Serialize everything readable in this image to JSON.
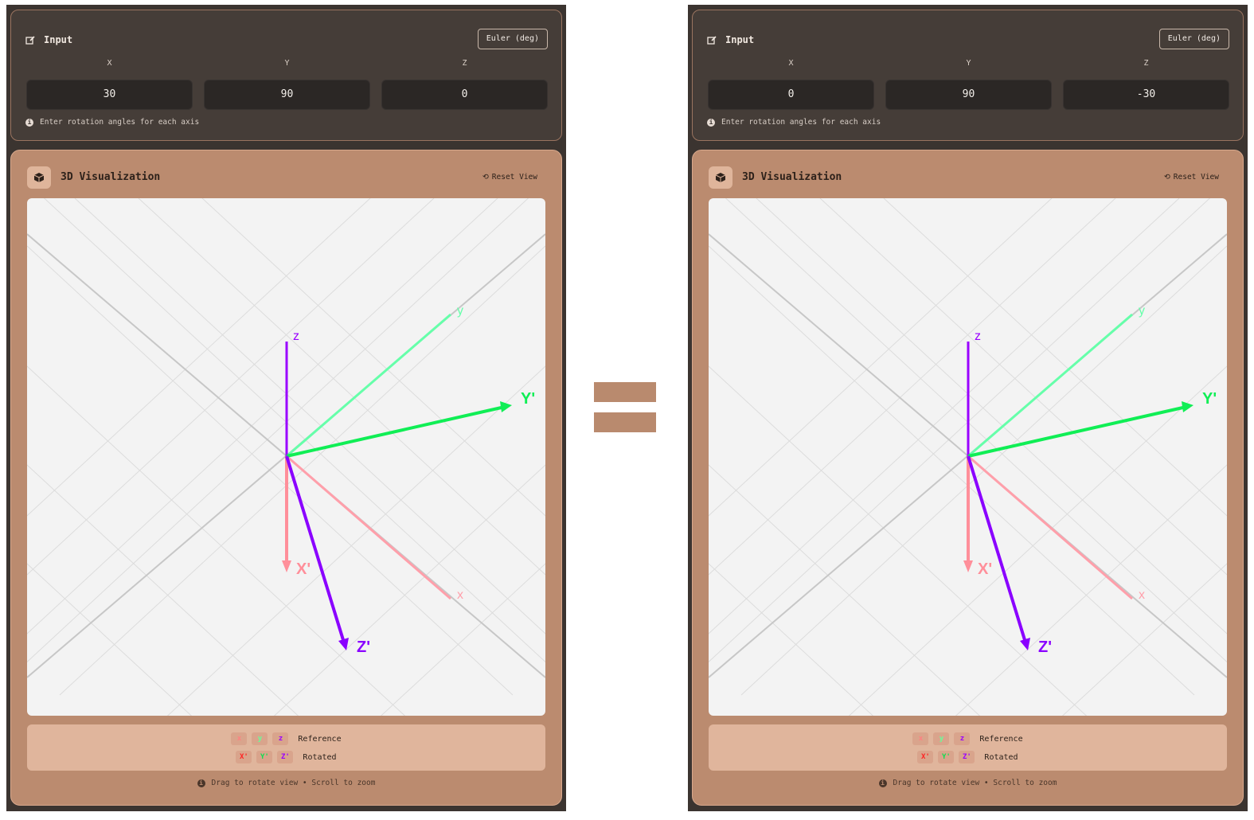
{
  "colors": {
    "panel_bg": "#3b3430",
    "viz_bg": "#bb8b6f",
    "ref_x": "#ff8f9a",
    "ref_y": "#66ffaa",
    "ref_z": "#9a00ff",
    "rot_x": "#ff8f9a",
    "rot_y": "#10ee55",
    "rot_z": "#8a00ff"
  },
  "panels": [
    {
      "input": {
        "title": "Input",
        "mode_button": "Euler (deg)",
        "axes": [
          {
            "label": "X",
            "value": "30"
          },
          {
            "label": "Y",
            "value": "90"
          },
          {
            "label": "Z",
            "value": "0"
          }
        ],
        "hint": "Enter rotation angles for each axis"
      },
      "viz": {
        "title": "3D Visualization",
        "reset_label": "Reset View",
        "axis_labels": {
          "x": "x",
          "y": "y",
          "z": "z",
          "xp": "X'",
          "yp": "Y'",
          "zp": "Z'"
        },
        "legend": {
          "reference_chips": [
            "x",
            "y",
            "z"
          ],
          "reference_label": "Reference",
          "rotated_chips": [
            "X'",
            "Y'",
            "Z'"
          ],
          "rotated_label": "Rotated"
        },
        "footer": "Drag to rotate view • Scroll to zoom"
      }
    },
    {
      "input": {
        "title": "Input",
        "mode_button": "Euler (deg)",
        "axes": [
          {
            "label": "X",
            "value": "0"
          },
          {
            "label": "Y",
            "value": "90"
          },
          {
            "label": "Z",
            "value": "-30"
          }
        ],
        "hint": "Enter rotation angles for each axis"
      },
      "viz": {
        "title": "3D Visualization",
        "reset_label": "Reset View",
        "axis_labels": {
          "x": "x",
          "y": "y",
          "z": "z",
          "xp": "X'",
          "yp": "Y'",
          "zp": "Z'"
        },
        "legend": {
          "reference_chips": [
            "x",
            "y",
            "z"
          ],
          "reference_label": "Reference",
          "rotated_chips": [
            "X'",
            "Y'",
            "Z'"
          ],
          "rotated_label": "Rotated"
        },
        "footer": "Drag to rotate view • Scroll to zoom"
      }
    }
  ]
}
